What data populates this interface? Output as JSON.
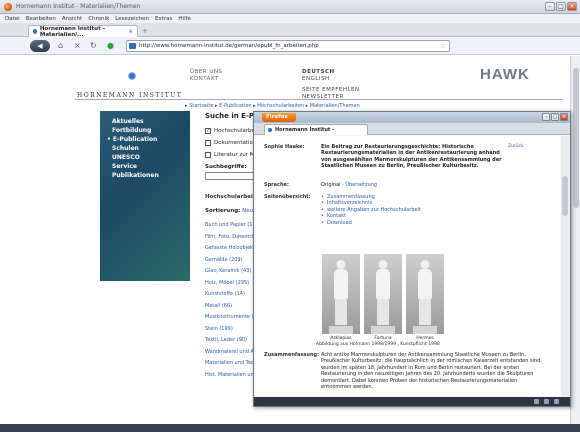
{
  "window": {
    "title": "Hornemann Institut - Materialien/Themen"
  },
  "menu": [
    "Datei",
    "Bearbeiten",
    "Ansicht",
    "Chronik",
    "Lesezeichen",
    "Extras",
    "Hilfe"
  ],
  "tab": {
    "label": "Hornemann Institut – Materialien/..."
  },
  "nav": {
    "url": "http://www.hornemann-institut.de/german/epubl_fn_arbeiten.php"
  },
  "site": {
    "logo_text": "HORNEMANN INSTITUT",
    "links_left": [
      "ÜBER UNS",
      "KONTAKT"
    ],
    "lang_current": "DEUTSCH",
    "lang_other": "ENGLISH",
    "recommend": [
      "SEITE EMPFEHLEN",
      "NEWSLETTER"
    ],
    "partner": "HAWK",
    "breadcrumb": [
      "Startseite",
      "E-Publication",
      "Hochschularbeiten",
      "Materialien/Themen"
    ]
  },
  "sidebar": [
    "Aktuelles",
    "Fortbildung",
    "E-Publication",
    "Schulen",
    "UNESCO",
    "Service",
    "Publikationen"
  ],
  "main": {
    "heading": "Suche in E-Publi",
    "checks": [
      {
        "label": "Hochschularbeiten",
        "checked": true
      },
      {
        "label": "Dokumentationen",
        "checked": false
      },
      {
        "label": "Literatur zur Möbe",
        "checked": false
      }
    ],
    "search_label": "Suchbegriffe:",
    "section": "Hochschularbeiten",
    "sort_label": "Sortierung:",
    "sort_value": "Neuzu",
    "categories": [
      "Buch und Papier (180",
      "Film, Foto, Datenträge",
      "Gefasste Holzobjekte",
      "Gemälde (209)",
      "Glas, Keramik (43)",
      "Holz, Möbel (295)",
      "Kunststoffe (14)",
      "Metall (66)",
      "Musikinstrumente (12",
      "Stein (199)",
      "Textil, Leder (90)",
      "Wandmalerei und Arc",
      "Materialien und Techr",
      "Hist. Materialien und"
    ]
  },
  "popup": {
    "app_button": "Firefox",
    "tab": "Hornemann Institut – Hochschularb...",
    "back_link": "Zurück",
    "author_label": "Sophie Haake:",
    "title_text": "Ein Beitrag zur Restaurierungsgeschichte: Historische Restaurierungsmaterialien in der Antikenrestaurierung anhand von ausgewählten Marmorskulpturen der Antikensammlung der Staatlichen Museen zu Berlin, Preußischer Kulturbesitz.",
    "lang_label": "Sprache:",
    "lang_value": "Original",
    "lang_alt": "Übersetzung",
    "overview_label": "Seitenübersicht:",
    "overview_items": [
      "Zusammenfassung",
      "Inhaltsverzeichnis",
      "weitere Angaben zur Hochschularbeit",
      "Kontakt",
      "Download"
    ],
    "statue_captions": [
      "Asklepios",
      "Fortuna",
      "Hermes"
    ],
    "figure_caption": "Abbildung aus Hofmann 1998/1999 , Kunstpflicht 1998",
    "summary_label": "Zusammenfassung:",
    "summary_text": "Acht antike Marmorskulpturen der Antikensammlung Staatliche Museen zu Berlin, Preußischer Kulturbesitz, die hauptsächlich in der römischen Kaiserzeit entstanden sind, wurden im späten 18. Jahrhundert in Rom und Berlin restauriert. Bei der ersten Restaurierung in den neuzeitigen Jahren des 20. Jahrhunderts wurden die Skulpturen demontiert. Dabei konnten Proben der historischen Restaurierungsmaterialien entnommen werden."
  }
}
